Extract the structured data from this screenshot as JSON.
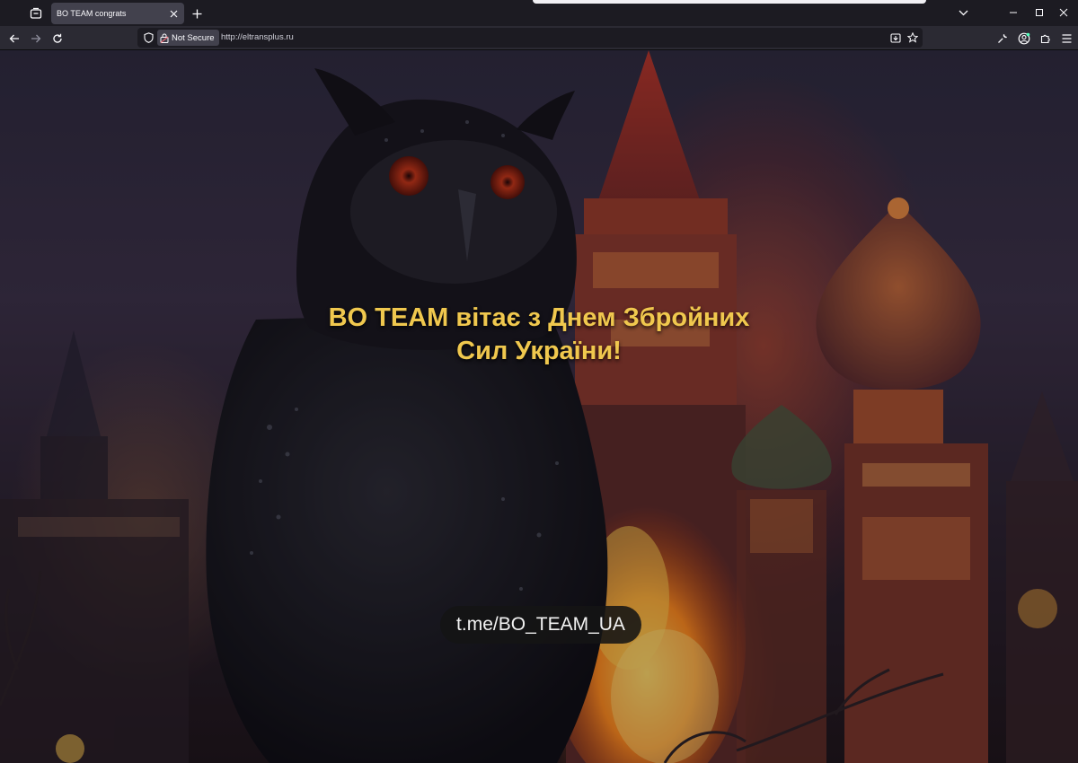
{
  "browser": {
    "tab_title": "BO TEAM congrats",
    "security_label": "Not Secure",
    "url": "http://eltransplus.ru"
  },
  "page": {
    "headline_line1": "BO TEAM вітає з Днем Збройних",
    "headline_line2": "Сил України!",
    "telegram_link": "t.me/BO_TEAM_UA"
  },
  "icons": {
    "tab_list": "tab-list-icon",
    "close": "close-icon",
    "new_tab": "plus-icon",
    "back": "arrow-left-icon",
    "forward": "arrow-right-icon",
    "reload": "reload-icon",
    "shield": "shield-icon",
    "lock": "lock-warning-icon",
    "save_to_pocket": "download-icon",
    "bookmark": "star-icon",
    "tools": "wrench-icon",
    "account": "account-icon",
    "extensions": "puzzle-icon",
    "menu": "hamburger-icon",
    "window_controls": [
      "chevron-down-icon",
      "minimize-icon",
      "maximize-icon",
      "close-icon"
    ]
  },
  "colors": {
    "headline": "#f0c84e",
    "chrome_dark": "#1c1b22",
    "chrome_toolbar": "#2b2a33",
    "link_pill": "#141414"
  }
}
